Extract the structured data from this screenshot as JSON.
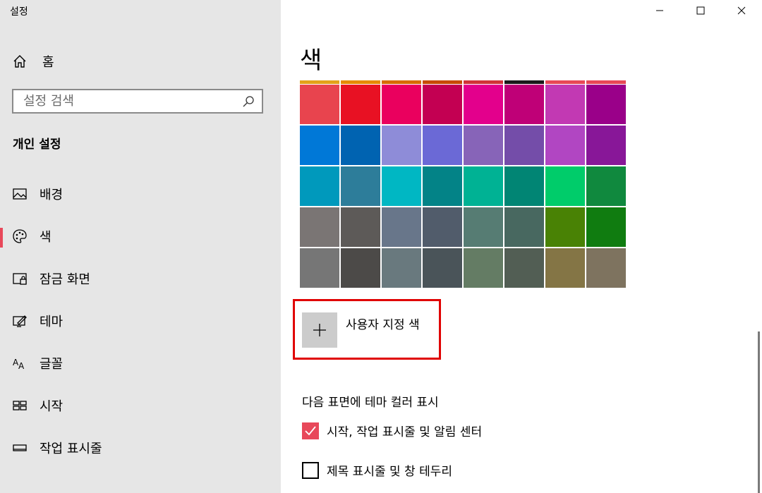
{
  "app": {
    "title": "설정"
  },
  "window_controls": {
    "minimize": "minimize-icon",
    "maximize": "maximize-icon",
    "close": "close-icon"
  },
  "sidebar": {
    "home_label": "홈",
    "search": {
      "placeholder": "설정 검색",
      "value": ""
    },
    "section_title": "개인 설정",
    "items": [
      {
        "label": "배경",
        "icon": "picture-icon",
        "selected": false
      },
      {
        "label": "색",
        "icon": "palette-icon",
        "selected": true
      },
      {
        "label": "잠금 화면",
        "icon": "lock-screen-icon",
        "selected": false
      },
      {
        "label": "테마",
        "icon": "theme-icon",
        "selected": false
      },
      {
        "label": "글꼴",
        "icon": "font-icon",
        "selected": false
      },
      {
        "label": "시작",
        "icon": "start-icon",
        "selected": false
      },
      {
        "label": "작업 표시줄",
        "icon": "taskbar-icon",
        "selected": false
      }
    ]
  },
  "main": {
    "title": "색",
    "accent_color": "#e8485a",
    "top_strip_colors": [
      "#e3a21a",
      "#e68a00",
      "#d86c00",
      "#c84b00",
      "#d13438",
      "#1a1a1a",
      "#e74856",
      "#e74856"
    ],
    "swatches": [
      "#e8444e",
      "#e81123",
      "#ea005e",
      "#c30052",
      "#e3008c",
      "#bf0077",
      "#c239b3",
      "#9a0089",
      "#0078d7",
      "#0063b1",
      "#8e8cd8",
      "#6b69d6",
      "#8764b8",
      "#744da9",
      "#b146c2",
      "#881798",
      "#0099bc",
      "#2d7d9a",
      "#00b7c3",
      "#038387",
      "#00b294",
      "#018574",
      "#00cc6a",
      "#10893e",
      "#7a7574",
      "#5d5a58",
      "#68768a",
      "#515c6b",
      "#567c73",
      "#486860",
      "#498205",
      "#107c10",
      "#767676",
      "#4c4a48",
      "#69797e",
      "#4a5459",
      "#647c64",
      "#525e54",
      "#847545",
      "#7e735f"
    ],
    "custom_color": {
      "label": "사용자 지정 색",
      "icon": "plus-icon"
    },
    "theme_heading": "다음 표면에 테마 컬러 표시",
    "checkboxes": [
      {
        "label": "시작, 작업 표시줄 및 알림 센터",
        "checked": true
      },
      {
        "label": "제목 표시줄 및 창 테두리",
        "checked": false
      }
    ]
  }
}
